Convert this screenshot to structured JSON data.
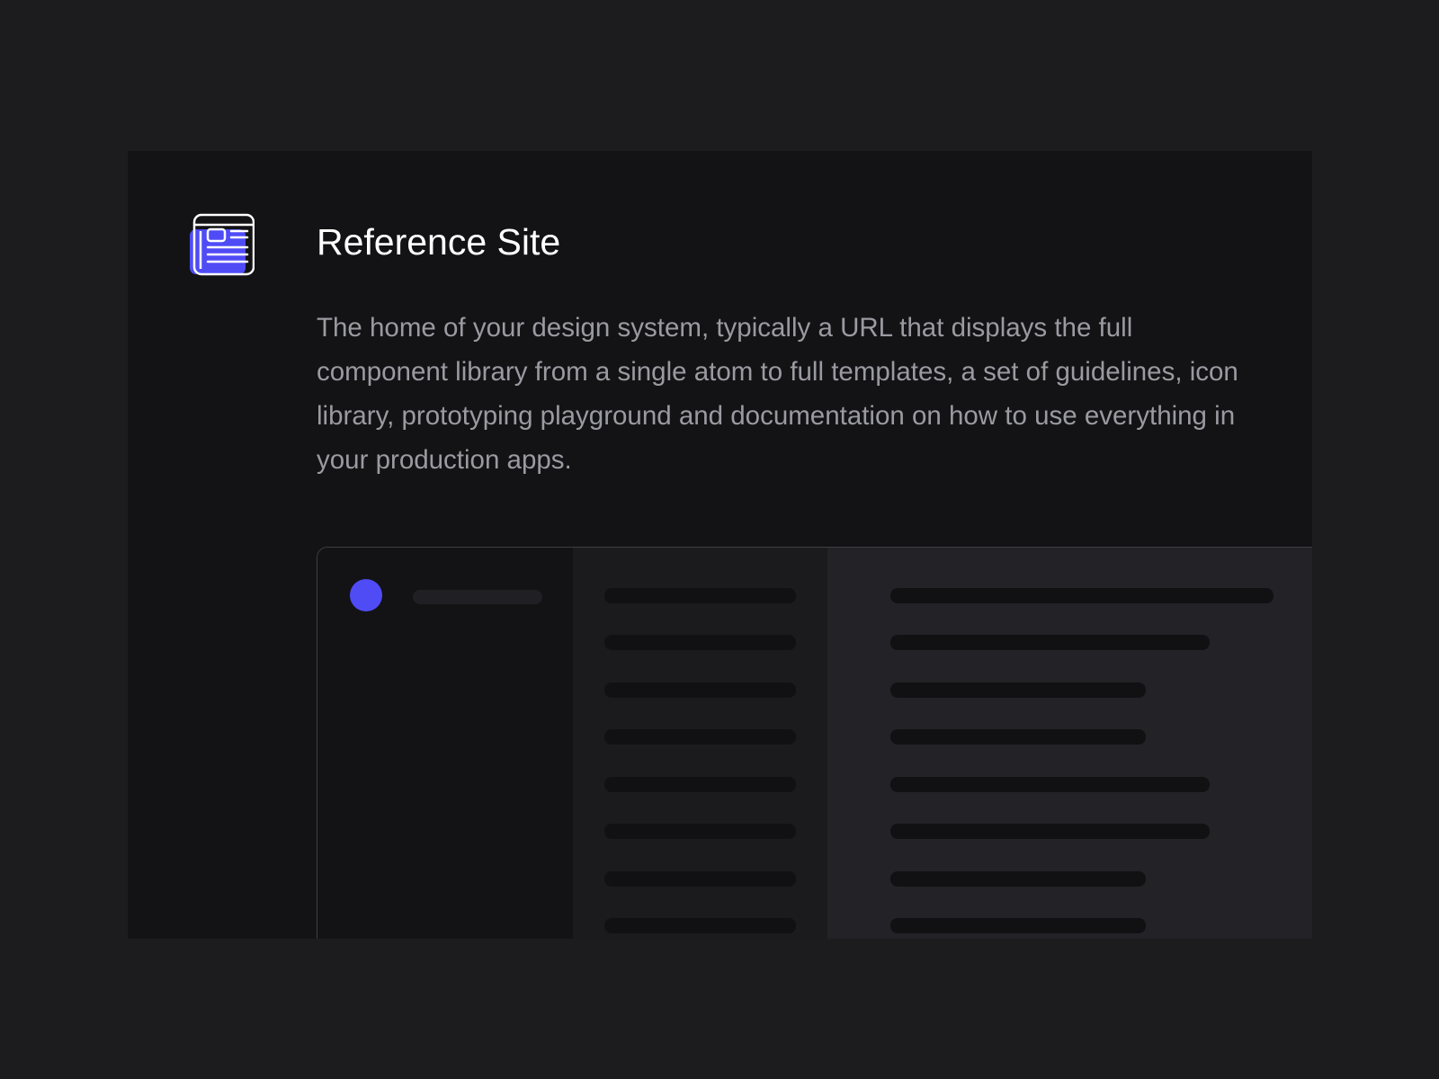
{
  "card": {
    "icon": "reference-site-icon",
    "title": "Reference Site",
    "description": "The home of your design system, typically a URL that displays the full component library from a single atom to full templates, a set of guidelines, icon library, prototyping playground and documentation on how to use everything in your production apps."
  },
  "colors": {
    "page_background": "#1c1c1f",
    "card_background": "#131316",
    "accent": "#4f4cf6",
    "title": "#ffffff",
    "body_text": "#9a9aa1",
    "preview_nav": "#1b1b1e",
    "preview_content": "#232327",
    "placeholder_bar": "#111113"
  }
}
